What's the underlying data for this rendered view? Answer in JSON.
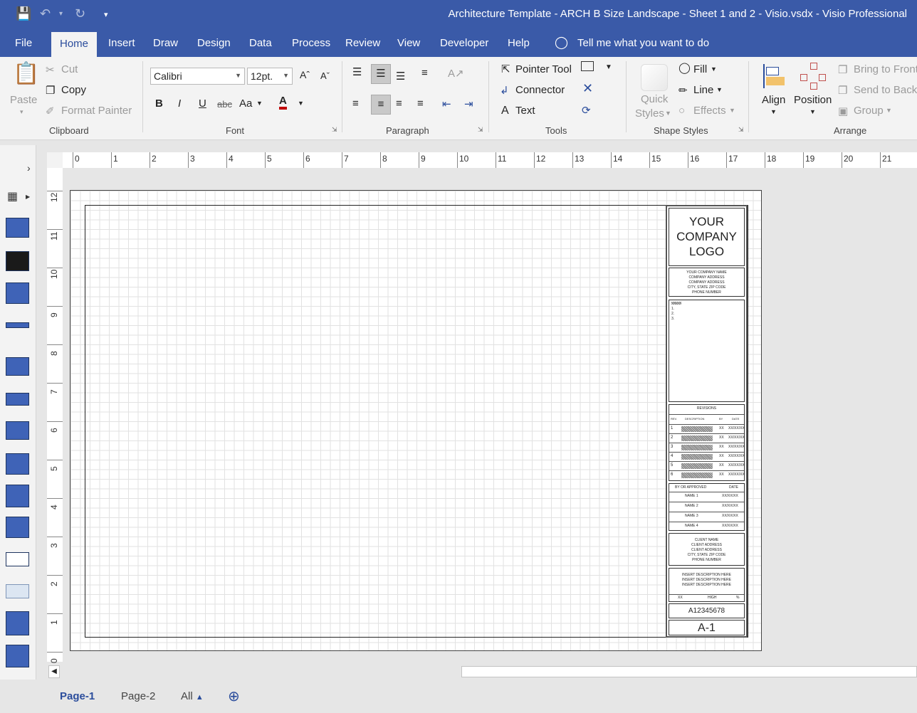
{
  "window": {
    "title": "Architecture Template - ARCH B Size Landscape - Sheet 1 and 2 - Visio.vsdx  -  Visio Professional"
  },
  "ribbon_tabs": [
    "File",
    "Home",
    "Insert",
    "Draw",
    "Design",
    "Data",
    "Process",
    "Review",
    "View",
    "Developer",
    "Help"
  ],
  "tell_me": "Tell me what you want to do",
  "clipboard": {
    "paste": "Paste",
    "cut": "Cut",
    "copy": "Copy",
    "format_painter": "Format Painter",
    "group": "Clipboard"
  },
  "font": {
    "name": "Calibri",
    "size": "12pt.",
    "group": "Font",
    "bold": "B",
    "italic": "I",
    "underline": "U",
    "strike": "abc",
    "case": "Aa",
    "color": "A"
  },
  "paragraph": {
    "group": "Paragraph"
  },
  "tools": {
    "pointer": "Pointer Tool",
    "connector": "Connector",
    "text": "Text",
    "group": "Tools"
  },
  "shape_styles": {
    "quick": "Quick",
    "styles": "Styles",
    "fill": "Fill",
    "line": "Line",
    "effects": "Effects",
    "group": "Shape Styles"
  },
  "arrange": {
    "align": "Align",
    "position": "Position",
    "bring_front": "Bring to Front",
    "send_back": "Send to Back",
    "group_btn": "Group",
    "group": "Arrange"
  },
  "ruler_h": [
    "0",
    "1",
    "2",
    "3",
    "4",
    "5",
    "6",
    "7",
    "8",
    "9",
    "10",
    "11",
    "12",
    "13",
    "14",
    "15",
    "16",
    "17",
    "18",
    "19",
    "20",
    "21"
  ],
  "ruler_v": [
    "12",
    "11",
    "10",
    "9",
    "8",
    "7",
    "6",
    "5",
    "4",
    "3",
    "2",
    "1",
    "0"
  ],
  "title_block": {
    "logo": [
      "YOUR",
      "COMPANY",
      "LOGO"
    ],
    "company": [
      "YOUR COMPANY NAME",
      "COMPANY ADDRESS",
      "COMPANY ADDRESS",
      "CITY, STATE ZIP CODE",
      "PHONE NUMBER"
    ],
    "notes": [
      "1.",
      "2.",
      "3."
    ],
    "revisions_title": "REVISIONS",
    "rev_headers": [
      "REV.",
      "DESCRIPTION",
      "BY",
      "DATE"
    ],
    "rev_rows": [
      {
        "n": "1",
        "by": "XX",
        "date": "XX/XX/XX"
      },
      {
        "n": "2",
        "by": "XX",
        "date": "XX/XX/XX"
      },
      {
        "n": "3",
        "by": "XX",
        "date": "XX/XX/XX"
      },
      {
        "n": "4",
        "by": "XX",
        "date": "XX/XX/XX"
      },
      {
        "n": "5",
        "by": "XX",
        "date": "XX/XX/XX"
      },
      {
        "n": "6",
        "by": "XX",
        "date": "XX/XX/XX"
      }
    ],
    "approved_header": "BY OR APPROVED",
    "date_header": "DATE",
    "approvers": [
      {
        "name": "NAME 1",
        "date": "XX/XX/XX"
      },
      {
        "name": "NAME 2",
        "date": "XX/XX/XX"
      },
      {
        "name": "NAME 3",
        "date": "XX/XX/XX"
      },
      {
        "name": "NAME 4",
        "date": "XX/XX/XX"
      }
    ],
    "client": [
      "CLIENT NAME",
      "CLIENT ADDRESS",
      "CLIENT ADDRESS",
      "CITY, STATE ZIP CODE",
      "PHONE NUMBER"
    ],
    "description": [
      "INSERT DESCRIPTION HERE",
      "INSERT DESCRIPTION HERE",
      "INSERT DESCRIPTION HERE"
    ],
    "scale_row": [
      "XX",
      "HIGH",
      "%"
    ],
    "number": "A12345678",
    "sheet": "A-1"
  },
  "page_tabs": [
    "Page-1",
    "Page-2",
    "All"
  ]
}
